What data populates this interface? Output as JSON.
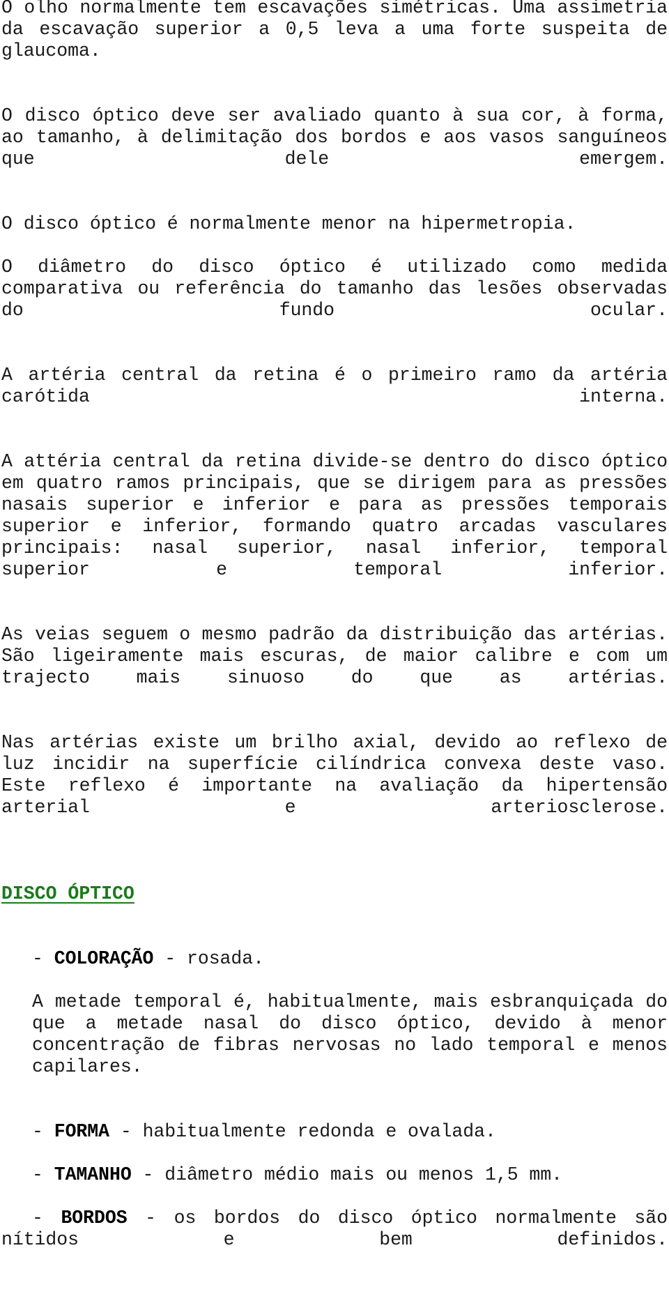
{
  "document": {
    "language": "pt-PT",
    "accent_color": "#1a7a1a",
    "text_color": "#1a1a1a",
    "background_color": "#ffffff",
    "paragraphs": [
      {
        "id": "p-escavacoes",
        "text": "O olho normalmente tem escavações simétricas. Uma assimetria da escavação superior a 0,5 leva a uma forte suspeita de glaucoma."
      },
      {
        "id": "p-avaliacao-disco",
        "text": "O disco óptico deve ser avaliado quanto à sua cor, à forma, ao tamanho, à delimitação dos bordos e aos vasos sanguíneos que dele emergem."
      },
      {
        "id": "p-hipermetropia",
        "text": "O disco óptico é normalmente menor na hipermetropia."
      },
      {
        "id": "p-diametro",
        "text": "O diâmetro do disco óptico é utilizado como medida comparativa ou referência do tamanho das lesões observadas do fundo ocular."
      },
      {
        "id": "p-arteria-central",
        "text": "A artéria central da retina é o primeiro ramo da artéria carótida interna."
      },
      {
        "id": "p-divisao-ramos",
        "text": "A attéria central da retina divide-se dentro do disco óptico em quatro ramos principais, que se dirigem para as pressões nasais superior e inferior e para as pressões temporais superior e inferior, formando quatro arcadas vasculares principais: nasal superior, nasal inferior, temporal superior e temporal inferior."
      },
      {
        "id": "p-veias",
        "text": "As veias seguem o mesmo padrão da distribuição das artérias. São ligeiramente mais escuras, de maior calibre e com um trajecto mais sinuoso do que as artérias."
      },
      {
        "id": "p-brilho-axial",
        "text": "Nas artérias existe um brilho axial, devido ao reflexo de luz incidir na superfície cilíndrica convexa deste vaso. Este reflexo é importante na avaliação da hipertensão arterial e arteriosclerose."
      }
    ],
    "section": {
      "heading": "DISCO ÓPTICO",
      "items": [
        {
          "id": "item-coloracao",
          "dash_before": "-",
          "label": "COLORAÇÃO",
          "dash_after": "-",
          "value": "rosada."
        },
        {
          "id": "item-forma",
          "dash_before": "-",
          "label": "FORMA",
          "dash_after": "-",
          "value": "habitualmente redonda e ovalada."
        },
        {
          "id": "item-tamanho",
          "dash_before": "-",
          "label": "TAMANHO",
          "dash_after": "-",
          "value": "diâmetro médio mais ou menos 1,5 mm."
        },
        {
          "id": "item-bordos",
          "dash_before": "-",
          "label": "BORDOS",
          "dash_after": "-",
          "value": "os bordos do disco óptico normalmente são nítidos e bem definidos."
        }
      ],
      "coloracao_note": "A metade temporal é, habitualmente, mais esbranquiçada do que a metade nasal do disco óptico, devido à menor concentração de fibras nervosas no lado temporal e menos capilares."
    }
  }
}
